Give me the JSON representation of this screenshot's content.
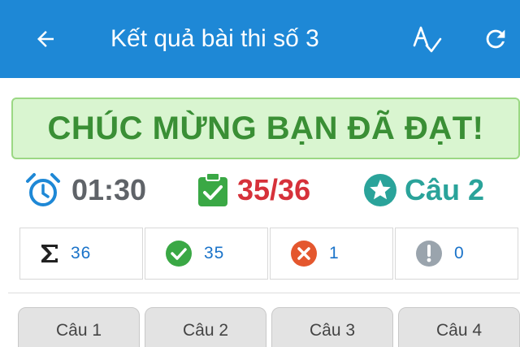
{
  "appbar": {
    "title": "Kết quả bài thi số 3",
    "back_icon": "arrow-left-icon",
    "font_icon": "spellcheck-icon",
    "refresh_icon": "refresh-icon",
    "background_color": "#1e88d6"
  },
  "banner": {
    "text": "CHÚC MỪNG BẠN ĐÃ ĐẠT!",
    "color": "#3a8f35",
    "background": "#d9f5d0"
  },
  "stats": {
    "time": "01:30",
    "score": "35/36",
    "question": "Câu 2",
    "score_color": "#d6313a",
    "question_color": "#2aa39a"
  },
  "summary": {
    "total": "36",
    "correct": "35",
    "wrong": "1",
    "unanswered": "0"
  },
  "questions": [
    {
      "label": "Câu 1"
    },
    {
      "label": "Câu 2"
    },
    {
      "label": "Câu 3"
    },
    {
      "label": "Câu 4"
    }
  ]
}
